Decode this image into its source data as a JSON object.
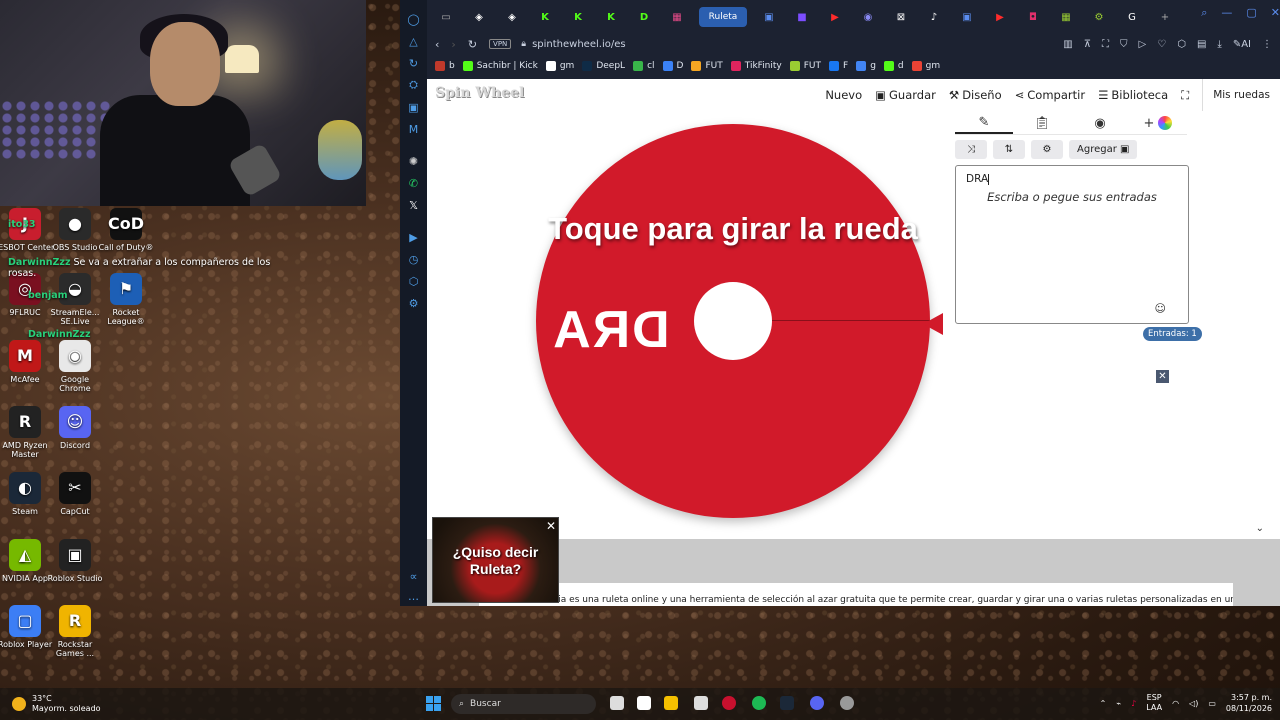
{
  "desktop": {
    "icons": [
      {
        "label": "JESBOT Center",
        "color": "#c81e2e",
        "glyph": "J"
      },
      {
        "label": "OBS Studio",
        "color": "#2a2a2a",
        "glyph": "●"
      },
      {
        "label": "Call of Duty®",
        "color": "#111111",
        "glyph": "CoD"
      },
      {
        "label": "9FLRUC",
        "color": "#7a1020",
        "glyph": "◎"
      },
      {
        "label": "StreamEle... SE.Live",
        "color": "#2b2b2b",
        "glyph": "◒"
      },
      {
        "label": "Rocket League®",
        "color": "#1d5fb6",
        "glyph": "⚑"
      },
      {
        "label": "McAfee",
        "color": "#c01818",
        "glyph": "M"
      },
      {
        "label": "Google Chrome",
        "color": "#e8e8e8",
        "glyph": "◉"
      },
      {
        "label": "AMD Ryzen Master",
        "color": "#222222",
        "glyph": "R"
      },
      {
        "label": "Discord",
        "color": "#5865f2",
        "glyph": "☺"
      },
      {
        "label": "Steam",
        "color": "#1b2838",
        "glyph": "◐"
      },
      {
        "label": "CapCut",
        "color": "#111111",
        "glyph": "✂"
      },
      {
        "label": "NVIDIA App",
        "color": "#76b900",
        "glyph": "◭"
      },
      {
        "label": "Roblox Studio",
        "color": "#222222",
        "glyph": "▣"
      },
      {
        "label": "Roblox Player",
        "color": "#3c7ef5",
        "glyph": "▢"
      },
      {
        "label": "Rockstar Games ...",
        "color": "#f0b400",
        "glyph": "R"
      }
    ]
  },
  "chat": {
    "line1_name": "DarwinnZzz",
    "line1_text": "Se va a extrañar a los compañeros de los rosas.",
    "line2_name": "benjam",
    "line3_name": "DarwinnZzz",
    "line0_name": "ito33"
  },
  "browser": {
    "active_tab": "Ruleta",
    "url": "spinthewheel.io/es",
    "vpn": "VPN",
    "bookmarks": [
      {
        "label": "b",
        "color": "#c0392b"
      },
      {
        "label": "Sachibr | Kick",
        "color": "#53fc18"
      },
      {
        "label": "gm",
        "color": "#ffffff"
      },
      {
        "label": "DeepL",
        "color": "#0f2b46"
      },
      {
        "label": "cl",
        "color": "#39b54a"
      },
      {
        "label": "D",
        "color": "#3b82f6"
      },
      {
        "label": "FUT",
        "color": "#f5a623"
      },
      {
        "label": "TikFinity",
        "color": "#e0245e"
      },
      {
        "label": "FUT",
        "color": "#9acd32"
      },
      {
        "label": "F",
        "color": "#1877f2"
      },
      {
        "label": "g",
        "color": "#4285f4"
      },
      {
        "label": "d",
        "color": "#53fc18"
      },
      {
        "label": "gm",
        "color": "#ea4335"
      }
    ]
  },
  "site": {
    "logo": "Spin Wheel",
    "nav": {
      "nuevo": "Nuevo",
      "guardar": "Guardar",
      "diseno": "Diseño",
      "compartir": "Compartir",
      "biblioteca": "Biblioteca",
      "mis_ruedas": "Mis ruedas"
    },
    "wheel": {
      "cta": "Toque para girar la rueda",
      "entry": "DRA",
      "color": "#d11a2a"
    },
    "editor": {
      "agregar": "Agregar",
      "value": "DRA",
      "placeholder": "Escriba o pegue sus entradas",
      "entries_badge": "Entradas: 1"
    },
    "info_text": "Ruleta aleatoria es una ruleta online y una herramienta de selección al azar gratuita que te permite crear, guardar y girar una o varias ruletas personalizadas en una misma",
    "ad_text": "¿Quiso decir Ruleta?"
  },
  "taskbar": {
    "temp": "33°C",
    "weather": "Mayorm. soleado",
    "search": "Buscar",
    "lang1": "ESP",
    "lang2": "LAA",
    "time": "3:57 p. m.",
    "date": "08/11/2026"
  }
}
